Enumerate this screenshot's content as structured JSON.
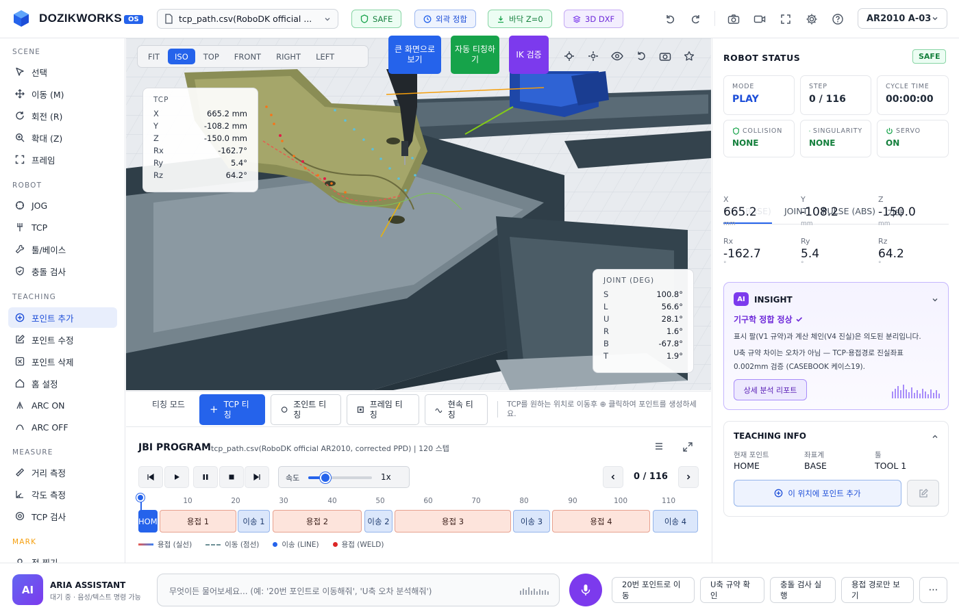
{
  "header": {
    "brand": "DOZIKWORKS",
    "version": "OS",
    "file_name": "tcp_path.csv(RoboDK official ...",
    "badges": [
      {
        "label": "SAFE",
        "icon": "shield-icon"
      },
      {
        "label": "외곽 정합",
        "icon": "clock-icon"
      },
      {
        "label": "바닥 Z=0",
        "icon": "download-icon"
      },
      {
        "label": "3D DXF",
        "icon": "layers-icon"
      }
    ],
    "robot_model": "AR2010 A-03"
  },
  "sidebar": {
    "sections": [
      {
        "title": "SCENE",
        "items": [
          "선택",
          "이동 (M)",
          "회전 (R)",
          "확대 (Z)",
          "프레임"
        ]
      },
      {
        "title": "ROBOT",
        "items": [
          "JOG",
          "TCP",
          "툴/베이스",
          "충돌 검사"
        ]
      },
      {
        "title": "TEACHING",
        "items": [
          "포인트 추가",
          "포인트 수정",
          "포인트 삭제",
          "홈 설정",
          "ARC ON",
          "ARC OFF"
        ]
      },
      {
        "title": "MEASURE",
        "items": [
          "거리 측정",
          "각도 측정",
          "TCP 검사"
        ]
      },
      {
        "title": "MARK",
        "items": [
          "점 찍기"
        ]
      }
    ],
    "active_item": "포인트 추가"
  },
  "viewport": {
    "views": [
      "FIT",
      "ISO",
      "TOP",
      "FRONT",
      "RIGHT",
      "LEFT"
    ],
    "active_view": "ISO",
    "action_buttons": [
      {
        "label": "큰 화면으로 보기",
        "color": "#2563eb"
      },
      {
        "label": "자동 티칭하기",
        "color": "#16a34a"
      },
      {
        "label": "IK 검증",
        "color": "#7c3aed"
      }
    ],
    "tcp": {
      "title": "TCP",
      "rows": [
        {
          "k": "X",
          "v": "665.2 mm"
        },
        {
          "k": "Y",
          "v": "-108.2 mm"
        },
        {
          "k": "Z",
          "v": "-150.0 mm"
        },
        {
          "k": "Rx",
          "v": "-162.7°"
        },
        {
          "k": "Ry",
          "v": "5.4°"
        },
        {
          "k": "Rz",
          "v": "64.2°"
        }
      ]
    },
    "joint": {
      "title": "JOINT (DEG)",
      "rows": [
        {
          "k": "S",
          "v": "100.8°"
        },
        {
          "k": "L",
          "v": "56.6°"
        },
        {
          "k": "U",
          "v": "28.1°"
        },
        {
          "k": "R",
          "v": "1.6°"
        },
        {
          "k": "B",
          "v": "-67.8°"
        },
        {
          "k": "T",
          "v": "1.9°"
        }
      ]
    }
  },
  "teaching_bar": {
    "mode_label": "티칭 모드",
    "buttons": [
      "TCP 티칭",
      "조인트 티칭",
      "프레임 티칭",
      "현속 티칭"
    ],
    "active": "TCP 티칭",
    "hint": "TCP를 원하는 위치로 이동후 ⊕ 클릭하여 포인트를 생성하세요."
  },
  "jbi": {
    "title": "JBI PROGRAM",
    "subtitle": "tcp_path.csv(RoboDK official AR2010, corrected PPD) | 120 스텝",
    "speed_label": "속도",
    "speed_value": "1x",
    "speed_fraction": 0.27,
    "step_counter": "0 / 116",
    "ticks": [
      "10",
      "20",
      "30",
      "40",
      "50",
      "60",
      "70",
      "80",
      "90",
      "100",
      "110"
    ],
    "segments": [
      {
        "label": "HOME",
        "type": "home"
      },
      {
        "label": "용접 1",
        "type": "weld"
      },
      {
        "label": "이송 1",
        "type": "move"
      },
      {
        "label": "용접 2",
        "type": "weld"
      },
      {
        "label": "이송 2",
        "type": "move"
      },
      {
        "label": "용접 3",
        "type": "weld"
      },
      {
        "label": "이송 3",
        "type": "move"
      },
      {
        "label": "용접 4",
        "type": "weld"
      },
      {
        "label": "이송 4",
        "type": "move"
      }
    ],
    "legend": [
      "용접 (실선)",
      "이동 (점선)",
      "이송 (LINE)",
      "용접 (WELD)"
    ]
  },
  "status": {
    "title": "ROBOT STATUS",
    "safe": "SAFE",
    "cards": [
      {
        "label": "MODE",
        "value": "PLAY"
      },
      {
        "label": "STEP",
        "value": "0 / 116"
      },
      {
        "label": "CYCLE TIME",
        "value": "00:00:00"
      },
      {
        "label": "COLLISION",
        "value": "NONE"
      },
      {
        "label": "SINGULARITY",
        "value": "NONE"
      },
      {
        "label": "SERVO",
        "value": "ON"
      }
    ],
    "tabs": [
      "TCP (BASE)",
      "JOINT",
      "PULSE (ABS)",
      "기타"
    ],
    "coords": [
      {
        "label": "X",
        "value": "665.2",
        "unit": "mm"
      },
      {
        "label": "Y",
        "value": "-108.2",
        "unit": "mm"
      },
      {
        "label": "Z",
        "value": "-150.0",
        "unit": "mm"
      },
      {
        "label": "Rx",
        "value": "-162.7",
        "unit": "°"
      },
      {
        "label": "Ry",
        "value": "5.4",
        "unit": "°"
      },
      {
        "label": "Rz",
        "value": "64.2",
        "unit": "°"
      }
    ]
  },
  "insight": {
    "title": "INSIGHT",
    "headline": "기구학 정합 정상",
    "line1": "표시 팔(V1 규약)과 계산 체인(V4 진실)은 의도된 분리입니다.",
    "line2": "U축 규약 차이는 오차가 아님 — TCP·용접경로 진실좌표 0.002mm 검증 (CASEBOOK 케이스19).",
    "button": "상세 분석 리포트"
  },
  "teaching_info": {
    "title": "TEACHING INFO",
    "fields": [
      {
        "label": "현재 포인트",
        "value": "HOME"
      },
      {
        "label": "좌표계",
        "value": "BASE"
      },
      {
        "label": "툴",
        "value": "TOOL 1"
      }
    ],
    "add_button": "이 위치에 포인트 추가"
  },
  "assistant": {
    "avatar": "AI",
    "name": "ARIA ASSISTANT",
    "status": "대기 중 · 음성/텍스트 명령 가능",
    "placeholder": "무엇이든 물어보세요... (예: '20번 포인트로 이동해줘', 'U축 오차 분석해줘')",
    "quick_actions": [
      "20번 포인트로 이동",
      "U축 규약 확인",
      "충돌 검사 실행",
      "용접 경로만 보기"
    ]
  },
  "colors": {
    "accent": "#2563eb",
    "safe": "#16a34a",
    "purple": "#7c3aed",
    "weld": "#e85a4f",
    "move": "#3b82f6"
  }
}
